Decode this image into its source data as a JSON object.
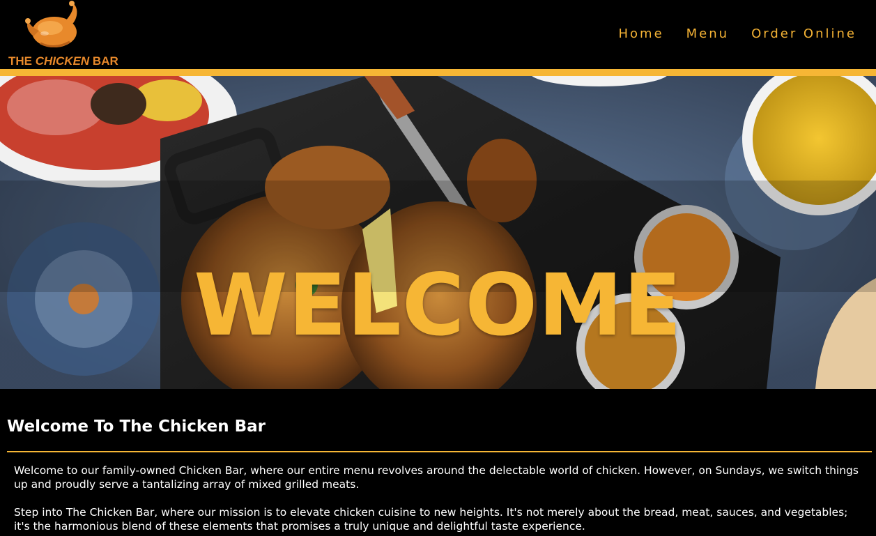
{
  "header": {
    "logo": {
      "text_prefix": "THE ",
      "text_emphasis": "CHICKEN",
      "text_suffix": " BAR",
      "icon": "roast-chicken-icon"
    },
    "nav": [
      {
        "label": "Home"
      },
      {
        "label": "Menu"
      },
      {
        "label": "Order Online"
      }
    ]
  },
  "hero": {
    "title": "WELCOME"
  },
  "main": {
    "section_title": "Welcome To The Chicken Bar",
    "paragraphs": [
      "Welcome to our family-owned Chicken Bar, where our entire menu revolves around the delectable world of chicken. However, on Sundays, we switch things up and proudly serve a tantalizing array of mixed grilled meats.",
      "Step into The Chicken Bar, where our mission is to elevate chicken cuisine to new heights. It's not merely about the bread, meat, sauces, and vegetables; it's the harmonious blend of these elements that promises a truly unique and delightful taste experience."
    ]
  },
  "colors": {
    "accent": "#f6b635",
    "logo_orange": "#e8892b",
    "background": "#000000"
  }
}
